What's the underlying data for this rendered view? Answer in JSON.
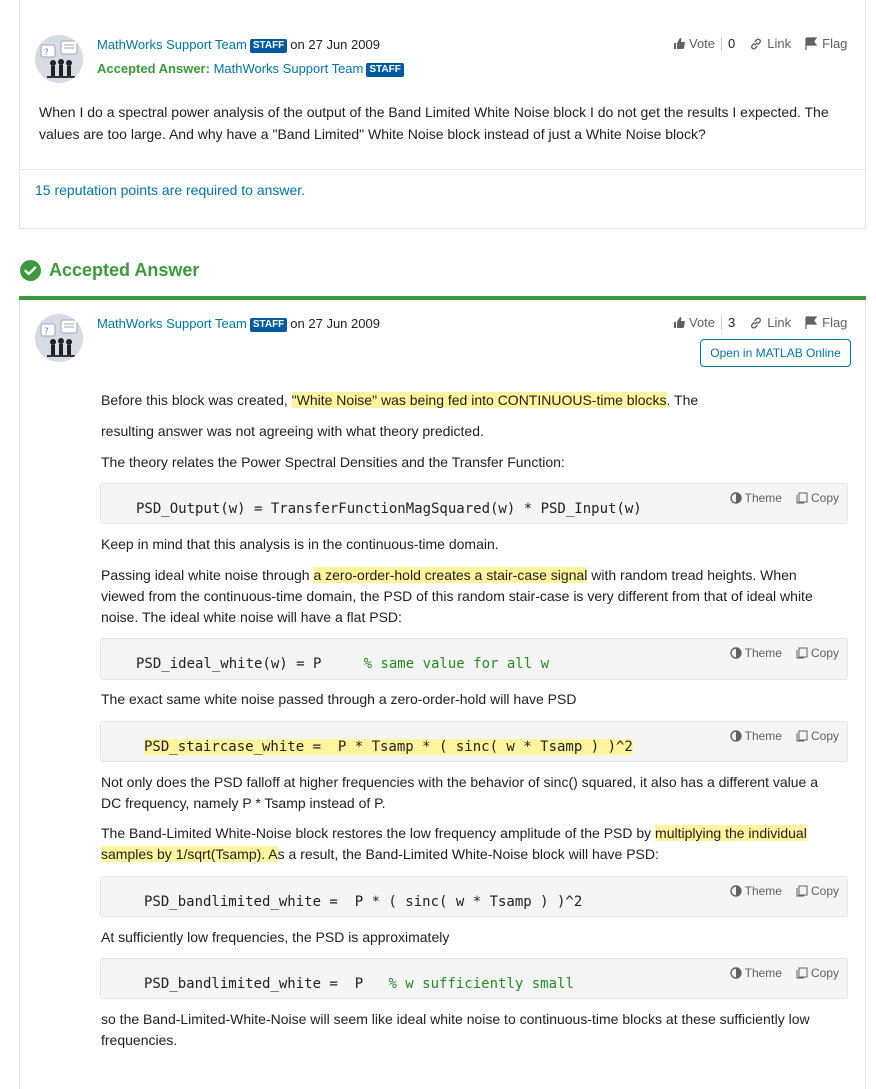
{
  "question": {
    "author": "MathWorks Support Team",
    "staff_badge": "STAFF",
    "date": "on 27 Jun 2009",
    "accepted_label": "Accepted Answer:",
    "accepted_author": "MathWorks Support Team",
    "accepted_staff_badge": "STAFF",
    "vote_label": "Vote",
    "vote_count": "0",
    "link_label": "Link",
    "flag_label": "Flag",
    "text": "When I do a spectral power analysis of the output of the Band Limited White Noise block I do not get the results I expected. The values are too large. And why have a \"Band Limited\" White Noise block instead of just a White Noise block?",
    "reputation_note": "15 reputation points are required to answer."
  },
  "accepted_answer": {
    "heading": "Accepted Answer",
    "author": "MathWorks Support Team",
    "staff_badge": "STAFF",
    "date": "on 27 Jun 2009",
    "vote_label": "Vote",
    "vote_count": "3",
    "link_label": "Link",
    "flag_label": "Flag",
    "open_matlab_label": "Open in MATLAB Online",
    "code_theme_label": "Theme",
    "code_copy_label": "Copy",
    "p1_a": "Before this block was created, ",
    "p1_hl": "\"White Noise\" was being fed into CONTINUOUS-time blocks",
    "p1_b": ". The",
    "p2": "resulting answer was not agreeing with what theory predicted.",
    "p3": "The theory relates the Power Spectral Densities and the Transfer Function:",
    "code1": "PSD_Output(w) = TransferFunctionMagSquared(w) * PSD_Input(w)",
    "p4": "Keep in mind that this analysis is in the continuous-time domain.",
    "p5_a": "Passing ideal white noise through ",
    "p5_hl": "a zero-order-hold creates a stair-case signal",
    "p5_b": " with random tread heights. When viewed from the continuous-time domain, the PSD of this random stair-case is very different from that of ideal white noise. The ideal white noise will have a flat PSD:",
    "code2": "PSD_ideal_white(w) = P     ",
    "code2_comment": "% same value for all w",
    "p6": "The exact same white noise passed through a zero-order-hold will have PSD",
    "code3": "PSD_staircase_white =  P * Tsamp * ( sinc( w * Tsamp ) )^2",
    "p7": "Not only does the PSD falloff at higher frequencies with the behavior of sinc() squared, it also has a different value a DC frequency, namely P * Tsamp instead of P.",
    "p8_a": "The Band-Limited White-Noise block restores the low frequency amplitude of the PSD by ",
    "p8_hl1": "multiplying the individual ",
    "p8_hl2": "samples by 1/sqrt(Tsamp). A",
    "p8_b": "s a result, the Band-Limited White-Noise block will have PSD:",
    "code4": "PSD_bandlimited_white =  P * ( sinc( w * Tsamp ) )^2",
    "p9": "At sufficiently low frequencies, the PSD is approximately",
    "code5": "PSD_bandlimited_white =  P   ",
    "code5_comment": "% w sufficiently small",
    "p10": "so the Band-Limited-White-Noise will seem like ideal white noise to continuous-time blocks at these sufficiently low frequencies."
  }
}
